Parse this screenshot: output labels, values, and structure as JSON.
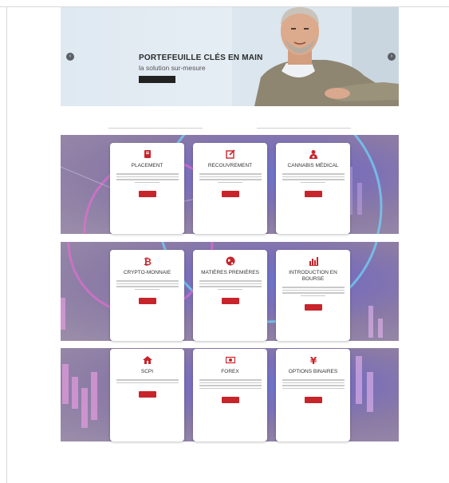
{
  "hero": {
    "title": "PORTEFEUILLE CLÉS EN MAIN",
    "subtitle": "la solution sur-mesure",
    "button_label": "",
    "accent": "#222222"
  },
  "section": {
    "title": ""
  },
  "colors": {
    "card_accent": "#c8242b",
    "band": "#7b6fb8"
  },
  "cards": [
    {
      "title": "PLACEMENT",
      "icon": "ledger-icon"
    },
    {
      "title": "RECOUVREMENT",
      "icon": "edit-icon"
    },
    {
      "title": "CANNABIS MÉDICAL",
      "icon": "doctor-icon"
    },
    {
      "title": "CRYPTO-MONNAIE",
      "icon": "bitcoin-icon"
    },
    {
      "title": "MATIÈRES PREMIÈRES",
      "icon": "globe-icon"
    },
    {
      "title": "INTRODUCTION EN BOURSE",
      "icon": "bar-chart-icon"
    },
    {
      "title": "SCPI",
      "icon": "home-icon"
    },
    {
      "title": "FOREX",
      "icon": "money-icon"
    },
    {
      "title": "OPTIONS BINAIRES",
      "icon": "yen-icon"
    }
  ]
}
